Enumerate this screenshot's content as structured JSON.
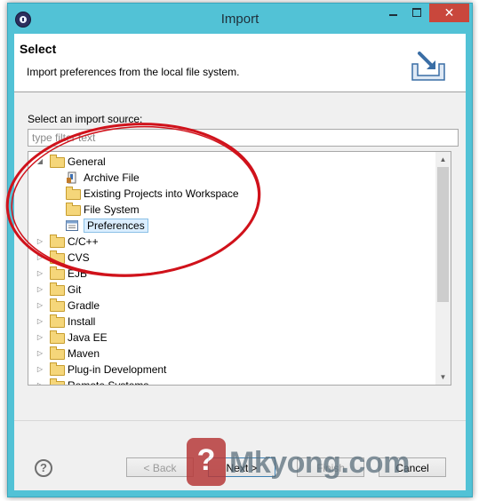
{
  "window": {
    "title": "Import",
    "close_glyph": "✕"
  },
  "header": {
    "title": "Select",
    "description": "Import preferences from the local file system.",
    "icon": "import-wizard-banner-icon"
  },
  "source": {
    "label": "Select an import source:",
    "filter_placeholder": "type filter text",
    "filter_value": ""
  },
  "tree": {
    "items": [
      {
        "label": "General",
        "level": 0,
        "expanded": true,
        "icon": "folder-icon"
      },
      {
        "label": "Archive File",
        "level": 1,
        "icon": "archive-file-icon"
      },
      {
        "label": "Existing Projects into Workspace",
        "level": 1,
        "icon": "open-folder-icon"
      },
      {
        "label": "File System",
        "level": 1,
        "icon": "folder-icon"
      },
      {
        "label": "Preferences",
        "level": 1,
        "icon": "preferences-icon",
        "selected": true
      },
      {
        "label": "C/C++",
        "level": 0,
        "expanded": false,
        "icon": "folder-icon"
      },
      {
        "label": "CVS",
        "level": 0,
        "expanded": false,
        "icon": "folder-icon"
      },
      {
        "label": "EJB",
        "level": 0,
        "expanded": false,
        "icon": "folder-icon"
      },
      {
        "label": "Git",
        "level": 0,
        "expanded": false,
        "icon": "folder-icon"
      },
      {
        "label": "Gradle",
        "level": 0,
        "expanded": false,
        "icon": "folder-icon"
      },
      {
        "label": "Install",
        "level": 0,
        "expanded": false,
        "icon": "folder-icon"
      },
      {
        "label": "Java EE",
        "level": 0,
        "expanded": false,
        "icon": "folder-icon"
      },
      {
        "label": "Maven",
        "level": 0,
        "expanded": false,
        "icon": "folder-icon"
      },
      {
        "label": "Plug-in Development",
        "level": 0,
        "expanded": false,
        "icon": "folder-icon"
      },
      {
        "label": "Remote Systems",
        "level": 0,
        "expanded": false,
        "icon": "folder-icon"
      }
    ]
  },
  "buttons": {
    "help": "?",
    "back": "< Back",
    "next": "Next >",
    "finish": "Finish",
    "cancel": "Cancel"
  },
  "watermark": {
    "icon_glyph": "?",
    "text": "Mkyong.com"
  },
  "colors": {
    "titlebar": "#52c2d6",
    "close_button": "#c9473c",
    "annotation_ellipse": "#d0121b",
    "selection": "#dbeeff"
  }
}
